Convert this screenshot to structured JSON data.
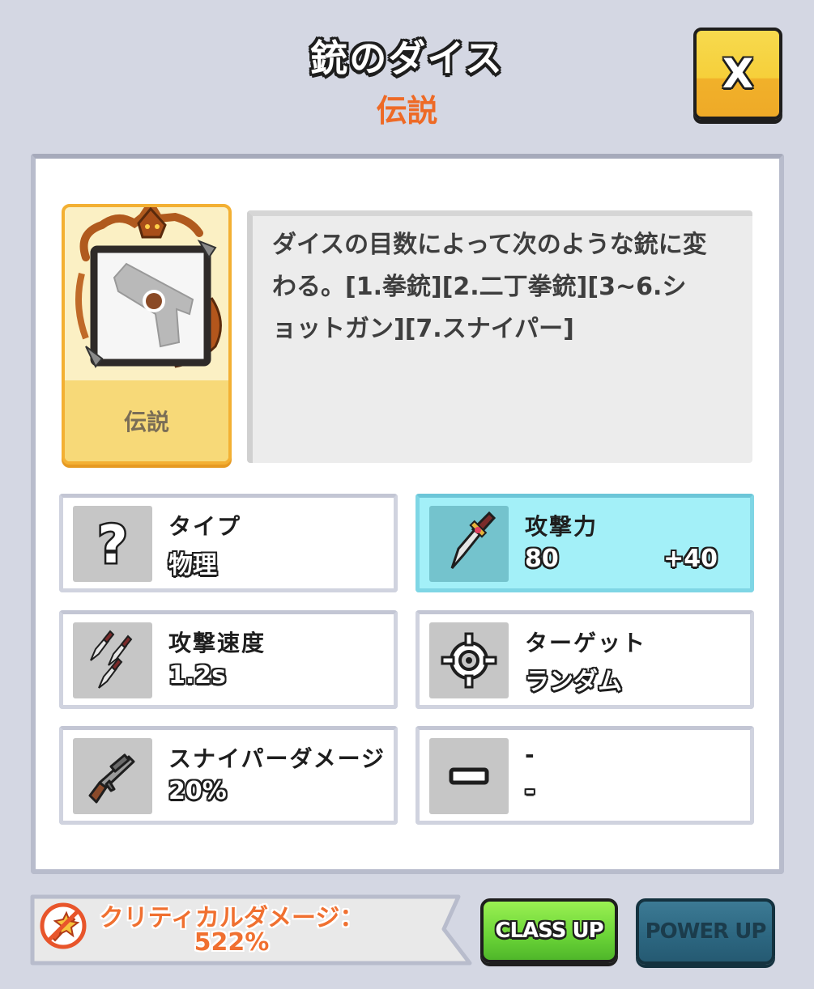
{
  "header": {
    "title": "銃のダイス",
    "rarity": "伝説",
    "close_label": "X"
  },
  "card": {
    "rarity_label": "伝説",
    "icon": "pistol-icon"
  },
  "description": "ダイスの目数によって次のような銃に変わる。[1.拳銃][2.二丁拳銃][3~6.ショットガン][7.スナイパー]",
  "stats": [
    {
      "icon": "question-icon",
      "label": "タイプ",
      "value": "物理",
      "bonus": ""
    },
    {
      "icon": "sword-icon",
      "label": "攻撃力",
      "value": "80",
      "bonus": "+40",
      "highlight": true
    },
    {
      "icon": "triple-sword-icon",
      "label": "攻撃速度",
      "value": "1.2s",
      "bonus": ""
    },
    {
      "icon": "crosshair-icon",
      "label": "ターゲット",
      "value": "ランダム",
      "bonus": ""
    },
    {
      "icon": "rifle-icon",
      "label": "スナイパーダメージ",
      "value": "20%",
      "bonus": ""
    },
    {
      "icon": "minus-icon",
      "label": "-",
      "value": "-",
      "bonus": ""
    }
  ],
  "footer": {
    "crit_label": "クリティカルダメージ：",
    "crit_value": "522%",
    "class_up": "CLASS UP",
    "power_up": "POWER UP"
  },
  "colors": {
    "background": "#d4d7e3",
    "rarity_orange": "#ee6a26",
    "close_yellow": "#f6cf3a",
    "highlight_cyan": "#a3f0f8",
    "class_up_green": "#6ad437",
    "power_up_teal": "#2c6680"
  }
}
